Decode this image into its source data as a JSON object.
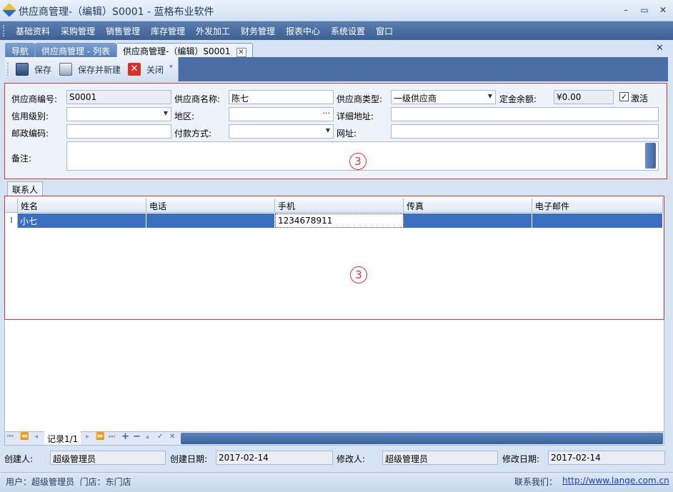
{
  "window": {
    "title": "供应商管理-（编辑）S0001 - 蓝格布业软件",
    "minimize": "–",
    "maximize": "▭",
    "close": "✕"
  },
  "menu": [
    "基础资料",
    "采购管理",
    "销售管理",
    "库存管理",
    "外发加工",
    "财务管理",
    "报表中心",
    "系统设置",
    "窗口"
  ],
  "tabs": {
    "nav": "导航",
    "list": "供应商管理 - 列表",
    "edit": "供应商管理-（编辑）S0001",
    "close_x": "✕",
    "doc_close": "✕"
  },
  "toolbar": {
    "save": "保存",
    "save_new": "保存并新建",
    "close": "关闭",
    "more": "▾"
  },
  "form": {
    "code_label": "供应商编号:",
    "code_value": "S0001",
    "name_label": "供应商名称:",
    "name_value": "陈七",
    "type_label": "供应商类型:",
    "type_value": "一级供应商",
    "deposit_label": "定金余额:",
    "deposit_value": "¥0.00",
    "active_label": "激活",
    "active_checked": true,
    "credit_label": "信用级别:",
    "credit_value": "",
    "region_label": "地区:",
    "region_value": "",
    "region_button": "···",
    "address_label": "详细地址:",
    "address_value": "",
    "postal_label": "邮政编码:",
    "postal_value": "",
    "payment_label": "付款方式:",
    "payment_value": "",
    "website_label": "网址:",
    "website_value": "",
    "remark_label": "备注:",
    "remark_value": "",
    "marker": "3"
  },
  "contacts": {
    "tab": "联系人",
    "columns": [
      "姓名",
      "电话",
      "手机",
      "传真",
      "电子邮件"
    ],
    "row_indicator": "I",
    "rows": [
      [
        "小七",
        "",
        "1234678911",
        "",
        ""
      ]
    ],
    "marker": "3"
  },
  "navigator": {
    "record": "记录1/1",
    "first": "⏮",
    "prev_page": "⏪",
    "prev": "◂",
    "next": "▸",
    "next_page": "⏩",
    "last": "⏭",
    "add": "+",
    "remove": "−",
    "up": "▴",
    "confirm": "✓",
    "cancel": "✕"
  },
  "footer": {
    "creator_label": "创建人:",
    "creator": "超级管理员",
    "created_label": "创建日期:",
    "created": "2017-02-14",
    "modifier_label": "修改人:",
    "modifier": "超级管理员",
    "modified_label": "修改日期:",
    "modified": "2017-02-14"
  },
  "status": {
    "user": "用户：超级管理员  门店：东门店",
    "contact_label": "联系我们：",
    "link": "http://www.lange.com.cn"
  }
}
